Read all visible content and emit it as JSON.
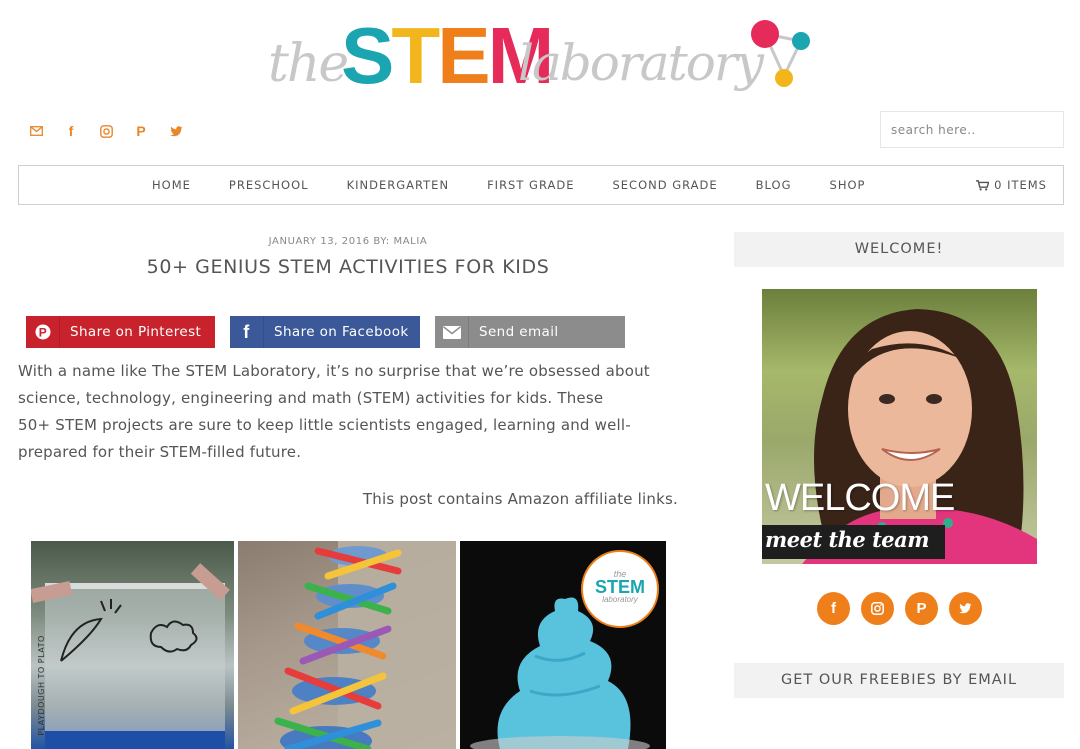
{
  "logo": {
    "the": "the",
    "stem_letters": [
      {
        "char": "S",
        "color": "#1aa5b1"
      },
      {
        "char": "T",
        "color": "#f2b51c"
      },
      {
        "char": "E",
        "color": "#ef7f1a"
      },
      {
        "char": "M",
        "color": "#e62b5a"
      }
    ],
    "laboratory": "laboratory"
  },
  "header": {
    "social_icons": [
      "mail-icon",
      "facebook-icon",
      "instagram-icon",
      "pinterest-icon",
      "twitter-icon"
    ],
    "search_placeholder": "search here.."
  },
  "nav": {
    "items": [
      "HOME",
      "PRESCHOOL",
      "KINDERGARTEN",
      "FIRST GRADE",
      "SECOND GRADE",
      "BLOG",
      "SHOP"
    ],
    "cart_label": "0 ITEMS"
  },
  "post": {
    "meta": "JANUARY 13, 2016 BY: MALIA",
    "title": "50+ GENIUS STEM ACTIVITIES FOR KIDS",
    "share": {
      "pinterest": "Share on Pinterest",
      "facebook": "Share on Facebook",
      "email": "Send email"
    },
    "body_lines": [
      "With a name like The STEM Laboratory, it’s no surprise that we’re obsessed about",
      "science, technology, engineering and math (STEM) activities for kids. These",
      "50+ STEM projects are sure to keep little scientists engaged, learning and well-",
      "prepared for their STEM-filled future."
    ],
    "affiliate": "This post contains Amazon affiliate links.",
    "photo_watermark": "PLAYDOUGH TO PLATO",
    "badge": {
      "the": "the",
      "stem": "STEM",
      "lab": "laboratory"
    }
  },
  "sidebar": {
    "welcome_title": "WELCOME!",
    "photo_welcome": "WELCOME",
    "photo_team": "meet the team",
    "social_icons": [
      "facebook-icon",
      "instagram-icon",
      "pinterest-icon",
      "twitter-icon"
    ],
    "freebies_title": "GET OUR FREEBIES BY EMAIL"
  },
  "colors": {
    "accent_orange": "#ef7f1a",
    "pinterest_red": "#c8232c",
    "facebook_blue": "#3b5998",
    "email_gray": "#8c8c8c"
  }
}
